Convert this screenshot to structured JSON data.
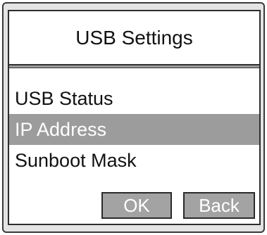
{
  "dialog": {
    "title": "USB Settings"
  },
  "menu": {
    "items": [
      {
        "label": "USB Status",
        "selected": false
      },
      {
        "label": "IP Address",
        "selected": true
      },
      {
        "label": "Sunboot Mask",
        "selected": false
      }
    ]
  },
  "buttons": {
    "ok_label": "OK",
    "back_label": "Back"
  },
  "colors": {
    "selection_bg": "#9c9c9c",
    "button_bg": "#a3a3a3",
    "frame": "#e4e4e4"
  }
}
